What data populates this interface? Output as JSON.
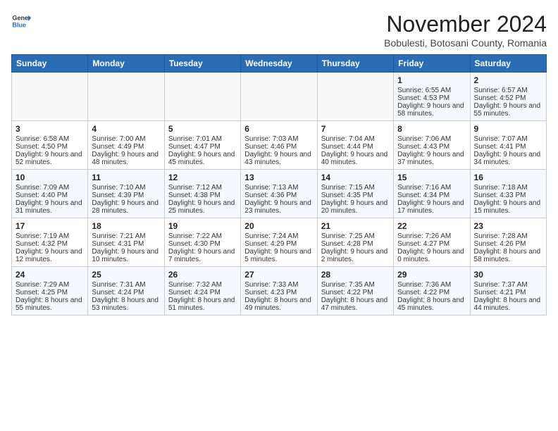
{
  "header": {
    "logo_general": "General",
    "logo_blue": "Blue",
    "month_title": "November 2024",
    "subtitle": "Bobulesti, Botosani County, Romania"
  },
  "calendar": {
    "days_of_week": [
      "Sunday",
      "Monday",
      "Tuesday",
      "Wednesday",
      "Thursday",
      "Friday",
      "Saturday"
    ],
    "weeks": [
      [
        {
          "day": "",
          "info": ""
        },
        {
          "day": "",
          "info": ""
        },
        {
          "day": "",
          "info": ""
        },
        {
          "day": "",
          "info": ""
        },
        {
          "day": "",
          "info": ""
        },
        {
          "day": "1",
          "info": "Sunrise: 6:55 AM\nSunset: 4:53 PM\nDaylight: 9 hours and 58 minutes."
        },
        {
          "day": "2",
          "info": "Sunrise: 6:57 AM\nSunset: 4:52 PM\nDaylight: 9 hours and 55 minutes."
        }
      ],
      [
        {
          "day": "3",
          "info": "Sunrise: 6:58 AM\nSunset: 4:50 PM\nDaylight: 9 hours and 52 minutes."
        },
        {
          "day": "4",
          "info": "Sunrise: 7:00 AM\nSunset: 4:49 PM\nDaylight: 9 hours and 48 minutes."
        },
        {
          "day": "5",
          "info": "Sunrise: 7:01 AM\nSunset: 4:47 PM\nDaylight: 9 hours and 45 minutes."
        },
        {
          "day": "6",
          "info": "Sunrise: 7:03 AM\nSunset: 4:46 PM\nDaylight: 9 hours and 43 minutes."
        },
        {
          "day": "7",
          "info": "Sunrise: 7:04 AM\nSunset: 4:44 PM\nDaylight: 9 hours and 40 minutes."
        },
        {
          "day": "8",
          "info": "Sunrise: 7:06 AM\nSunset: 4:43 PM\nDaylight: 9 hours and 37 minutes."
        },
        {
          "day": "9",
          "info": "Sunrise: 7:07 AM\nSunset: 4:41 PM\nDaylight: 9 hours and 34 minutes."
        }
      ],
      [
        {
          "day": "10",
          "info": "Sunrise: 7:09 AM\nSunset: 4:40 PM\nDaylight: 9 hours and 31 minutes."
        },
        {
          "day": "11",
          "info": "Sunrise: 7:10 AM\nSunset: 4:39 PM\nDaylight: 9 hours and 28 minutes."
        },
        {
          "day": "12",
          "info": "Sunrise: 7:12 AM\nSunset: 4:38 PM\nDaylight: 9 hours and 25 minutes."
        },
        {
          "day": "13",
          "info": "Sunrise: 7:13 AM\nSunset: 4:36 PM\nDaylight: 9 hours and 23 minutes."
        },
        {
          "day": "14",
          "info": "Sunrise: 7:15 AM\nSunset: 4:35 PM\nDaylight: 9 hours and 20 minutes."
        },
        {
          "day": "15",
          "info": "Sunrise: 7:16 AM\nSunset: 4:34 PM\nDaylight: 9 hours and 17 minutes."
        },
        {
          "day": "16",
          "info": "Sunrise: 7:18 AM\nSunset: 4:33 PM\nDaylight: 9 hours and 15 minutes."
        }
      ],
      [
        {
          "day": "17",
          "info": "Sunrise: 7:19 AM\nSunset: 4:32 PM\nDaylight: 9 hours and 12 minutes."
        },
        {
          "day": "18",
          "info": "Sunrise: 7:21 AM\nSunset: 4:31 PM\nDaylight: 9 hours and 10 minutes."
        },
        {
          "day": "19",
          "info": "Sunrise: 7:22 AM\nSunset: 4:30 PM\nDaylight: 9 hours and 7 minutes."
        },
        {
          "day": "20",
          "info": "Sunrise: 7:24 AM\nSunset: 4:29 PM\nDaylight: 9 hours and 5 minutes."
        },
        {
          "day": "21",
          "info": "Sunrise: 7:25 AM\nSunset: 4:28 PM\nDaylight: 9 hours and 2 minutes."
        },
        {
          "day": "22",
          "info": "Sunrise: 7:26 AM\nSunset: 4:27 PM\nDaylight: 9 hours and 0 minutes."
        },
        {
          "day": "23",
          "info": "Sunrise: 7:28 AM\nSunset: 4:26 PM\nDaylight: 8 hours and 58 minutes."
        }
      ],
      [
        {
          "day": "24",
          "info": "Sunrise: 7:29 AM\nSunset: 4:25 PM\nDaylight: 8 hours and 55 minutes."
        },
        {
          "day": "25",
          "info": "Sunrise: 7:31 AM\nSunset: 4:24 PM\nDaylight: 8 hours and 53 minutes."
        },
        {
          "day": "26",
          "info": "Sunrise: 7:32 AM\nSunset: 4:24 PM\nDaylight: 8 hours and 51 minutes."
        },
        {
          "day": "27",
          "info": "Sunrise: 7:33 AM\nSunset: 4:23 PM\nDaylight: 8 hours and 49 minutes."
        },
        {
          "day": "28",
          "info": "Sunrise: 7:35 AM\nSunset: 4:22 PM\nDaylight: 8 hours and 47 minutes."
        },
        {
          "day": "29",
          "info": "Sunrise: 7:36 AM\nSunset: 4:22 PM\nDaylight: 8 hours and 45 minutes."
        },
        {
          "day": "30",
          "info": "Sunrise: 7:37 AM\nSunset: 4:21 PM\nDaylight: 8 hours and 44 minutes."
        }
      ]
    ]
  }
}
